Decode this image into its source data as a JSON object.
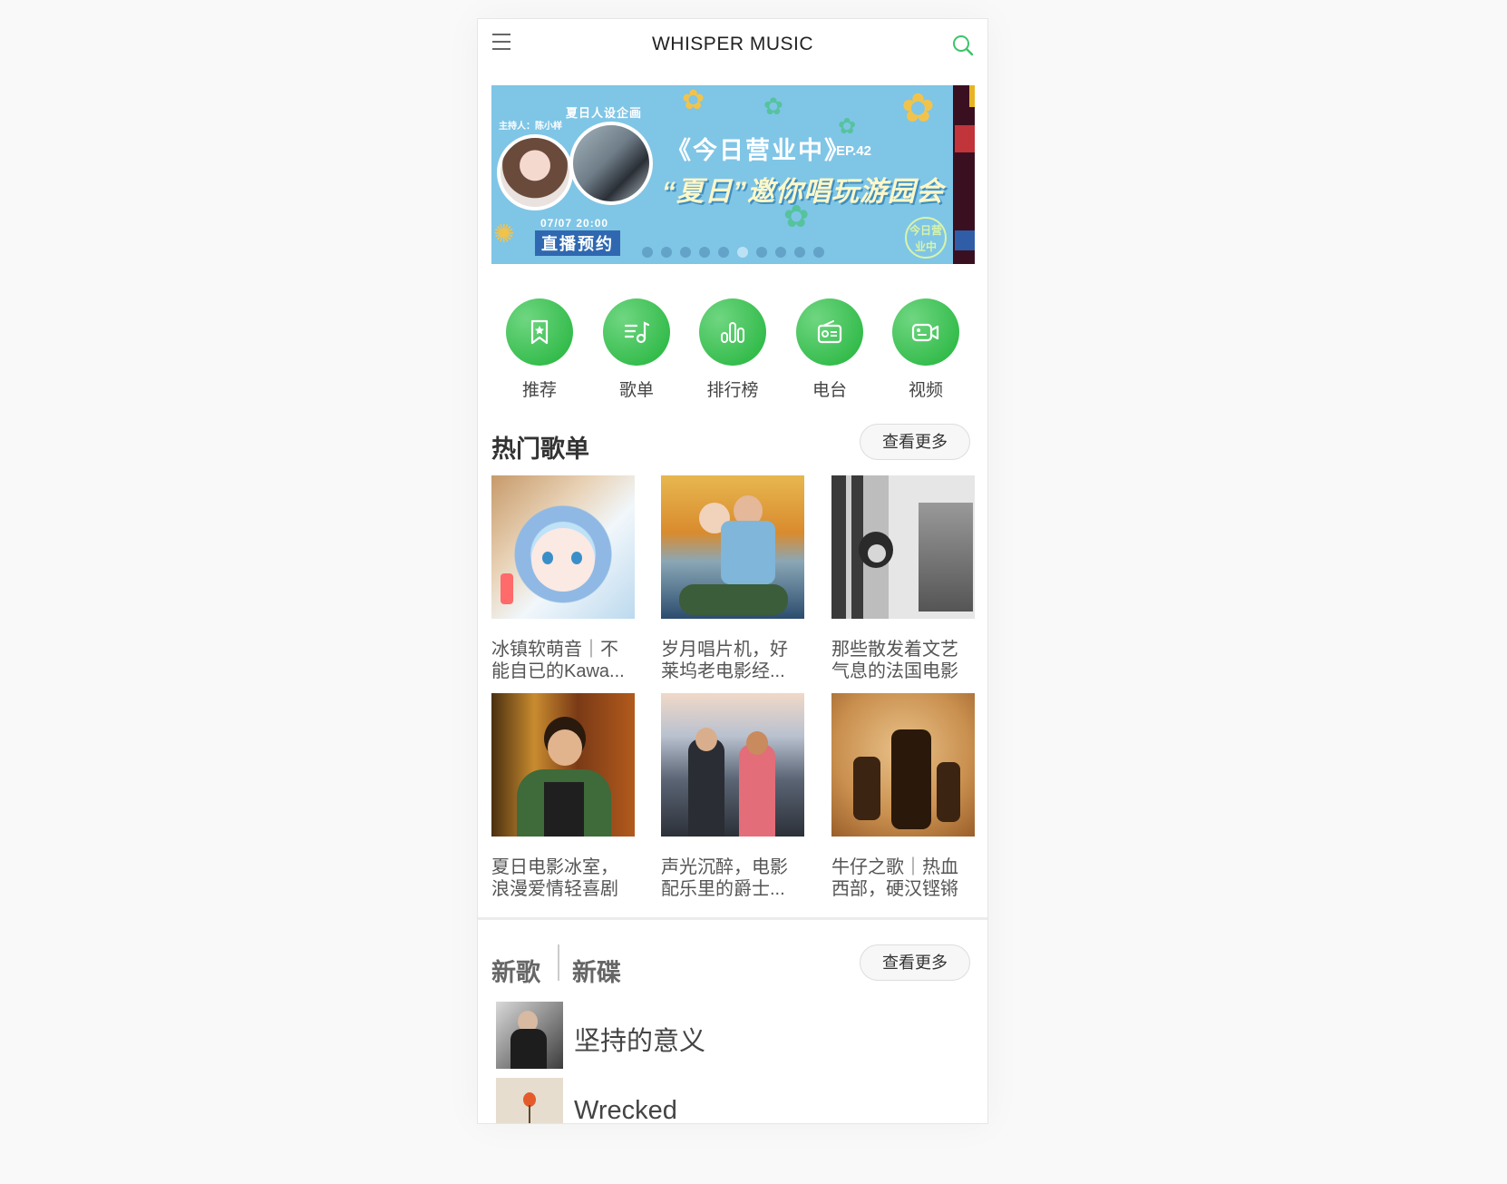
{
  "app": {
    "title": "WHISPER MUSIC"
  },
  "banner": {
    "host_line": "夏日人设企画",
    "host_name": "主持人：陈小样",
    "title_line1": "《今日营业中》",
    "episode": "EP.42",
    "title_line2": "“夏日”邀你唱玩游园会",
    "time": "07/07 20:00",
    "cta": "直播预约",
    "logo_text": "今日营业中",
    "dots_count": 10,
    "active_dot": 6
  },
  "nav": [
    {
      "label": "推荐",
      "icon": "bookmark-star-icon"
    },
    {
      "label": "歌单",
      "icon": "playlist-icon"
    },
    {
      "label": "排行榜",
      "icon": "chart-bars-icon"
    },
    {
      "label": "电台",
      "icon": "radio-icon"
    },
    {
      "label": "视频",
      "icon": "video-camera-icon"
    }
  ],
  "hot_playlists": {
    "title": "热门歌单",
    "more_label": "查看更多",
    "items": [
      {
        "title": "冰镇软萌音｜不能自已的Kawa..."
      },
      {
        "title": "岁月唱片机，好莱坞老电影经..."
      },
      {
        "title": "那些散发着文艺气息的法国电影"
      },
      {
        "title": "夏日电影冰室，浪漫爱情轻喜剧"
      },
      {
        "title": "声光沉醉，电影配乐里的爵士..."
      },
      {
        "title": "牛仔之歌｜热血西部，硬汉铿锵"
      }
    ]
  },
  "new_section": {
    "tab_songs": "新歌",
    "tab_albums": "新碟",
    "more_label": "查看更多",
    "songs": [
      {
        "name": "坚持的意义"
      },
      {
        "name": "Wrecked"
      }
    ]
  },
  "colors": {
    "accent_green": "#21b33a",
    "banner_bg": "#7fc5e6"
  }
}
